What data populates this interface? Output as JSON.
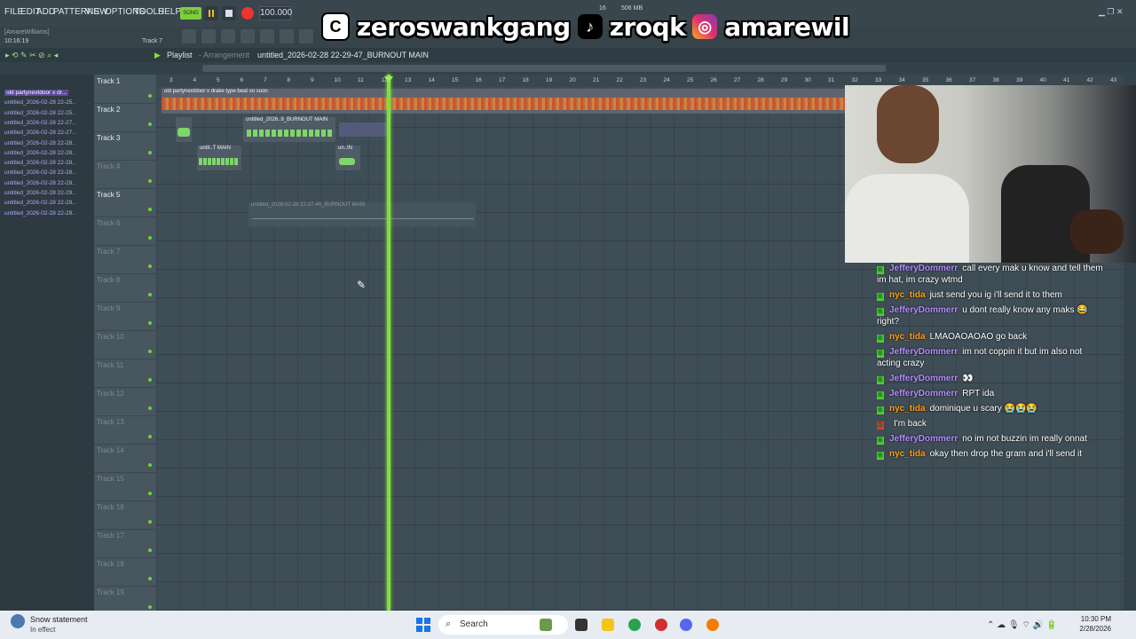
{
  "menu": {
    "items": [
      "FILE",
      "EDIT",
      "ADD",
      "PATTERNS",
      "VIEW",
      "OPTIONS",
      "TOOLS",
      "HELP"
    ],
    "song_mode": "SONG",
    "tempo": "100.000",
    "user_hint": "[AmareWilliams]",
    "time": "10:16:19",
    "track_hint": "Track 7",
    "cpu": "16",
    "memory": "506 MB"
  },
  "banner": {
    "capcut_handle": "zeroswankgang",
    "tiktok_handle": "zroqk",
    "instagram_handle": "amarewil"
  },
  "playlist": {
    "title": "Playlist",
    "subtitle": "- Arrangement",
    "pattern": "untitled_2026-02-28 22-29-47_BURNOUT MAIN"
  },
  "browser": {
    "items": [
      "old partynextdoor x dr...",
      "untitled_2026-02-28 22-25..",
      "untitled_2026-02-28 22-25..",
      "untitled_2026-02-28 22-27..",
      "untitled_2026-02-28 22-27..",
      "untitled_2026-02-28 22-28..",
      "untitled_2026-02-28 22-28..",
      "untitled_2026-02-28 22-28..",
      "untitled_2026-02-28 22-28..",
      "untitled_2026-02-28 22-29..",
      "untitled_2026-02-28 22-29..",
      "untitled_2026-02-28 22-29..",
      "untitled_2026-02-28 22-29.."
    ]
  },
  "tracks": [
    "Track 1",
    "Track 2",
    "Track 3",
    "Track 4",
    "Track 5",
    "Track 6",
    "Track 7",
    "Track 8",
    "Track 9",
    "Track 10",
    "Track 11",
    "Track 12",
    "Track 13",
    "Track 14",
    "Track 15",
    "Track 16",
    "Track 17",
    "Track 18",
    "Track 19"
  ],
  "ruler": [
    "3",
    "4",
    "5",
    "6",
    "7",
    "8",
    "9",
    "10",
    "11",
    "12",
    "13",
    "14",
    "15",
    "16",
    "17",
    "18",
    "19",
    "20",
    "21",
    "22",
    "23",
    "24",
    "25",
    "26",
    "27",
    "28",
    "29",
    "30",
    "31",
    "32",
    "33",
    "34",
    "35",
    "36",
    "37",
    "38",
    "39",
    "40",
    "41",
    "42",
    "43"
  ],
  "clips": {
    "c1": "old partynextdoor x drake type beat so soon",
    "c2": "untitled_2026..9_BURNOUT MAIN",
    "c3": "untit..T MAIN",
    "c4": "un..IN",
    "c5": "untitled_2026-02-28 22-27-46_BURNOUT MAIN"
  },
  "chat": [
    {
      "user": "JefferyDommerr",
      "color": "#b48cff",
      "text": "call every mak u know and tell them im hat, im crazy wtmd"
    },
    {
      "user": "nyc_tida",
      "color": "#ff9f1a",
      "text": "just send you ig i'll send it to them"
    },
    {
      "user": "JefferyDommerr",
      "color": "#b48cff",
      "text": "u dont really know any maks 😂 right?"
    },
    {
      "user": "nyc_tida",
      "color": "#ff9f1a",
      "text": "LMAOAOAOAO go back"
    },
    {
      "user": "JefferyDommerr",
      "color": "#b48cff",
      "text": "im not coppin it but im also not acting crazy"
    },
    {
      "user": "JefferyDommerr",
      "color": "#b48cff",
      "text": "👀"
    },
    {
      "user": "JefferyDommerr",
      "color": "#b48cff",
      "text": "RPT ida"
    },
    {
      "user": "nyc_tida",
      "color": "#ff9f1a",
      "text": "dominique u scary 😭😭😭"
    },
    {
      "user": "",
      "color": "#ff3b3b",
      "text": "I'm back"
    },
    {
      "user": "JefferyDommerr",
      "color": "#b48cff",
      "text": "no im not buzzin im really onnat"
    },
    {
      "user": "nyc_tida",
      "color": "#ff9f1a",
      "text": "okay then drop the gram and i'll send it"
    }
  ],
  "taskbar": {
    "weather_title": "Snow statement",
    "weather_sub": "In effect",
    "search": "Search",
    "time": "10:30 PM",
    "date": "2/28/2026"
  },
  "colors": {
    "accent": "#7ce23a",
    "background": "#3f4d56",
    "taskbar": "#e7ecf3"
  }
}
